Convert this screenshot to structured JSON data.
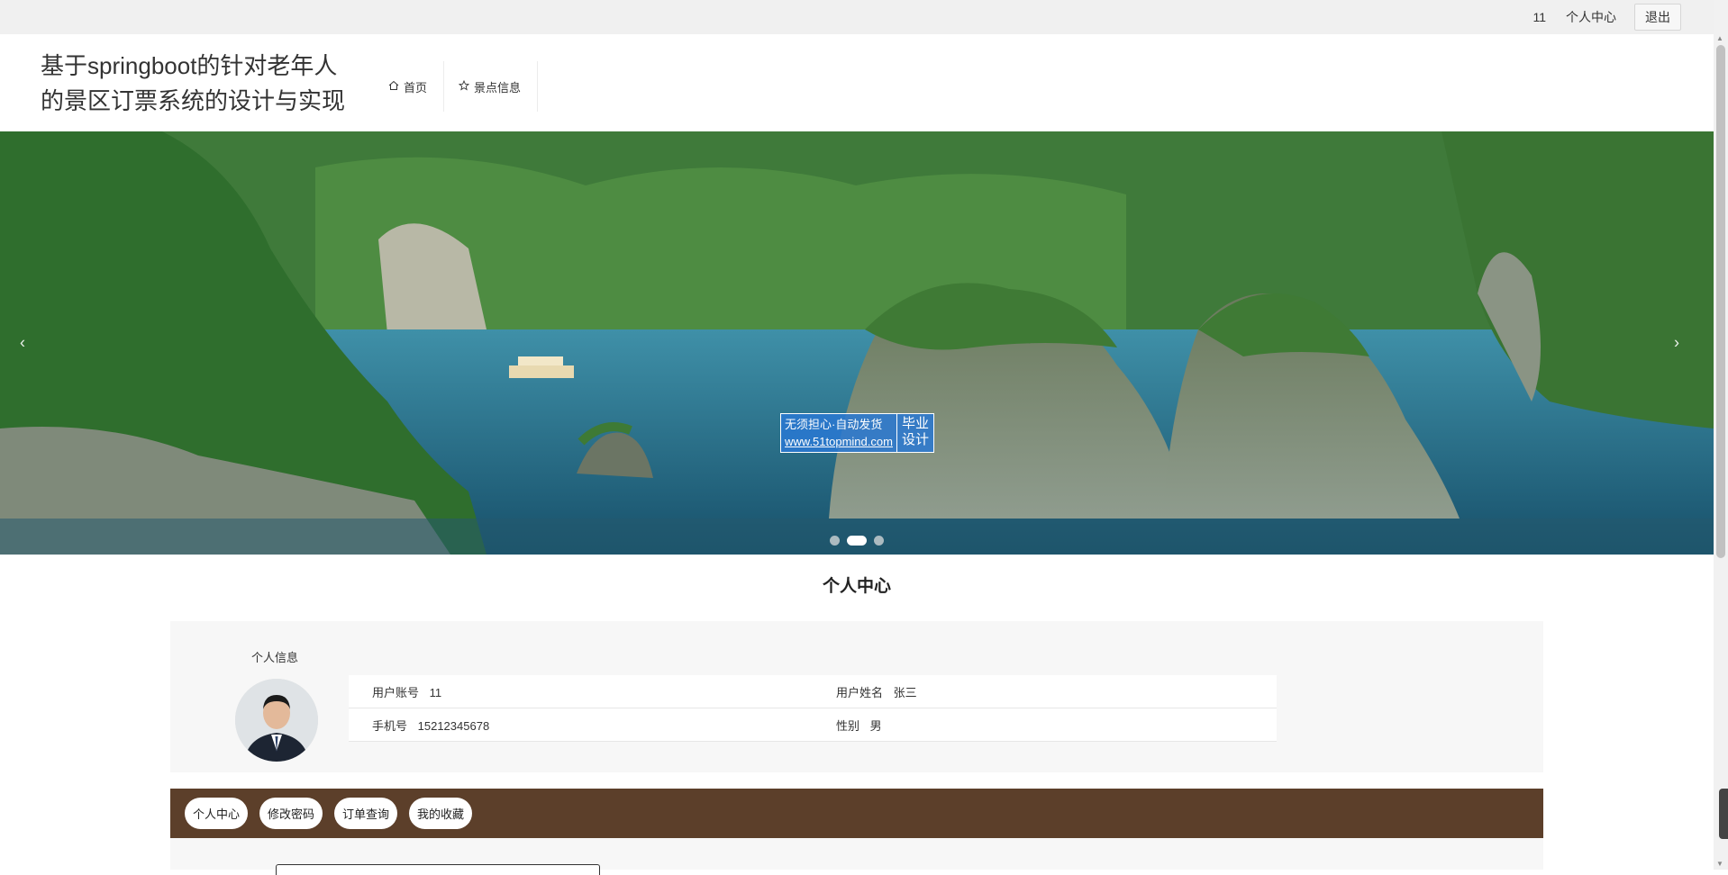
{
  "topbar": {
    "username": "11",
    "personal_center": "个人中心",
    "logout": "退出"
  },
  "header": {
    "site_title": "基于springboot的针对老年人的景区订票系统的设计与实现",
    "nav": [
      {
        "label": "首页",
        "icon": "home-icon"
      },
      {
        "label": "景点信息",
        "icon": "star-icon"
      }
    ]
  },
  "banner": {
    "prev": "‹",
    "next": "›",
    "slide_count": 3,
    "active_index": 1,
    "watermark": {
      "line1": "无须担心·自动发货",
      "url": "www.51topmind.com",
      "badge_line1": "毕业",
      "badge_line2": "设计"
    }
  },
  "main": {
    "section_title": "个人中心",
    "info": {
      "heading": "个人信息",
      "account_label": "用户账号",
      "account_value": "11",
      "name_label": "用户姓名",
      "name_value": "张三",
      "phone_label": "手机号",
      "phone_value": "15212345678",
      "gender_label": "性别",
      "gender_value": "男"
    },
    "tabs": [
      "个人中心",
      "修改密码",
      "订单查询",
      "我的收藏"
    ]
  },
  "colors": {
    "tab_bar": "#5c3f2a",
    "panel_bg": "#f7f7f7",
    "topbar_bg": "#f0f0f0"
  }
}
